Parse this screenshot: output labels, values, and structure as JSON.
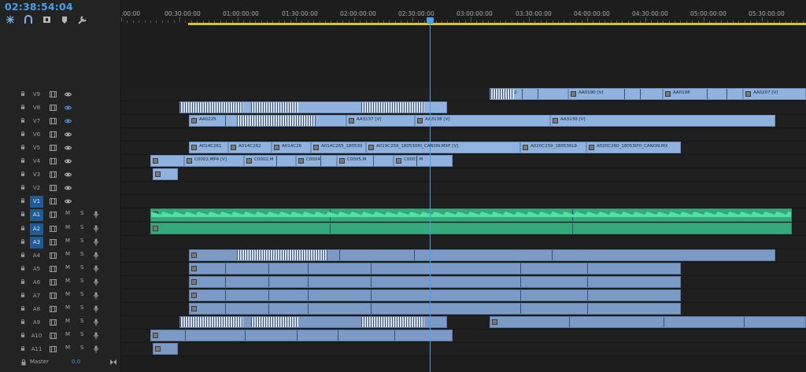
{
  "timecode": "02:38:54:04",
  "toolbar": [
    "snap-icon",
    "linked-selection-icon",
    "add-marker-icon",
    "markers-icon",
    "settings-icon"
  ],
  "ruler": {
    "labels": [
      ":00:00",
      "00:30:00:00",
      "01:00:00:00",
      "01:30:00:00",
      "02:00:00:00",
      "02:30:00:00",
      "03:00:00:00",
      "03:30:00:00",
      "04:00:00:00",
      "04:30:00:00",
      "05:00:00:00",
      "05:30:00:00"
    ]
  },
  "video_tracks": [
    {
      "name": "V9",
      "eye": "visible",
      "clips": [
        {
          "label": "AA0182"
        },
        {
          "label": "AA0190 [V]"
        },
        {
          "label": "AA0198"
        },
        {
          "label": "AA0207 [V]"
        }
      ]
    },
    {
      "name": "V8",
      "eye": "active",
      "clips": []
    },
    {
      "name": "V7",
      "eye": "active",
      "clips": [
        {
          "label": "AA0225"
        },
        {
          "label": "AA3137 [V]"
        },
        {
          "label": "AA3138 [V]"
        },
        {
          "label": "AA3139 [V]"
        }
      ]
    },
    {
      "name": "V6",
      "eye": "visible",
      "clips": []
    },
    {
      "name": "V5",
      "eye": "visible",
      "clips": [
        {
          "label": "A014C261"
        },
        {
          "label": "A014C262"
        },
        {
          "label": "A014C26"
        },
        {
          "label": "A014C265_180530"
        },
        {
          "label": "A019C258_180530HI_CANON.MXF [V]"
        },
        {
          "label": "A020C259_180530L9"
        },
        {
          "label": "A020C260_180530YI_CANON.MX"
        }
      ]
    },
    {
      "name": "V4",
      "eye": "visible",
      "clips": [
        {
          "label": "C0002.MP4 [V]"
        },
        {
          "label": "C0002.M"
        },
        {
          "label": "C0004"
        },
        {
          "label": "C0005.M"
        },
        {
          "label": "C0007.M"
        }
      ]
    },
    {
      "name": "V3",
      "eye": "visible",
      "clips": []
    },
    {
      "name": "V2",
      "eye": "visible",
      "clips": []
    },
    {
      "name": "V1",
      "eye": "visible",
      "clips": []
    }
  ],
  "audio_tracks": [
    {
      "name": "A1",
      "m": "M",
      "s": "S"
    },
    {
      "name": "A2",
      "m": "M",
      "s": "S"
    },
    {
      "name": "A3",
      "m": "M",
      "s": "S"
    },
    {
      "name": "A4",
      "m": "M",
      "s": "S"
    },
    {
      "name": "A5",
      "m": "M",
      "s": "S"
    },
    {
      "name": "A6",
      "m": "M",
      "s": "S"
    },
    {
      "name": "A7",
      "m": "M",
      "s": "S"
    },
    {
      "name": "A8",
      "m": "M",
      "s": "S"
    },
    {
      "name": "A9",
      "m": "M",
      "s": "S"
    },
    {
      "name": "A10",
      "m": "M",
      "s": "S"
    },
    {
      "name": "A11",
      "m": "M",
      "s": "S"
    }
  ],
  "master": {
    "label": "Master",
    "value": "0.0"
  },
  "colors": {
    "accent": "#4b9eea",
    "video_clip": "#8fb2df",
    "audio_clip": "#7b9ac5",
    "music_clip": "#36a87c",
    "work_area": "#d8c43a"
  }
}
